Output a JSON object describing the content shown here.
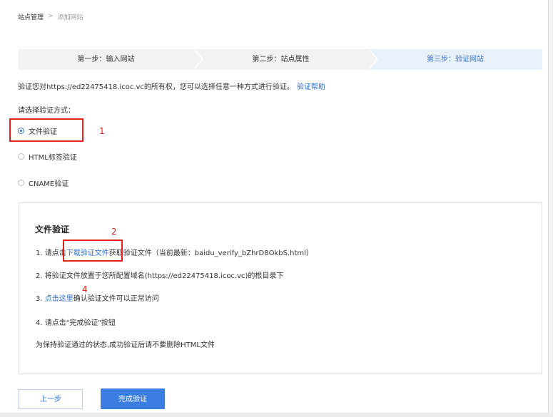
{
  "breadcrumb": {
    "root": "站点管理",
    "separator": ">",
    "current": "添加网站"
  },
  "steps": [
    {
      "label": "第一步：输入网站",
      "state": "done"
    },
    {
      "label": "第二步：站点属性",
      "state": "done"
    },
    {
      "label": "第三步：验证网站",
      "state": "active"
    }
  ],
  "intro": {
    "text": "验证您对https://ed22475418.icoc.vc的所有权，您可以选择任意一种方式进行验证。",
    "help_link": "验证帮助"
  },
  "method": {
    "label": "请选择验证方式：",
    "options": [
      {
        "label": "文件验证",
        "selected": true
      },
      {
        "label": "HTML标签验证",
        "selected": false
      },
      {
        "label": "CNAME验证",
        "selected": false
      }
    ]
  },
  "panel": {
    "title": "文件验证",
    "step1": {
      "prefix": "1.  请点击",
      "link": "下载验证文件",
      "suffix": "获取验证文件（当前最新：baidu_verify_bZhrD8OkbS.html）"
    },
    "step2": {
      "text": "2.  将验证文件放置于您所配置域名(https://ed22475418.icoc.vc)的根目录下"
    },
    "step3": {
      "prefix": "3.  ",
      "link": "点击这里",
      "suffix": "确认验证文件可以正常访问"
    },
    "step4": {
      "text": "4.  请点击\"完成验证\"按钮"
    },
    "note": "为保持验证通过的状态,成功验证后请不要删除HTML文件"
  },
  "annotations": {
    "marker_1": "1",
    "marker_2": "2",
    "marker_4": "4"
  },
  "buttons": {
    "prev": "上一步",
    "done": "完成验证"
  },
  "colors": {
    "link": "#2f6fd6",
    "primary_button": "#3b7de0",
    "active_step_bg": "#e9f1fb",
    "annotation_red": "#e2231a"
  }
}
